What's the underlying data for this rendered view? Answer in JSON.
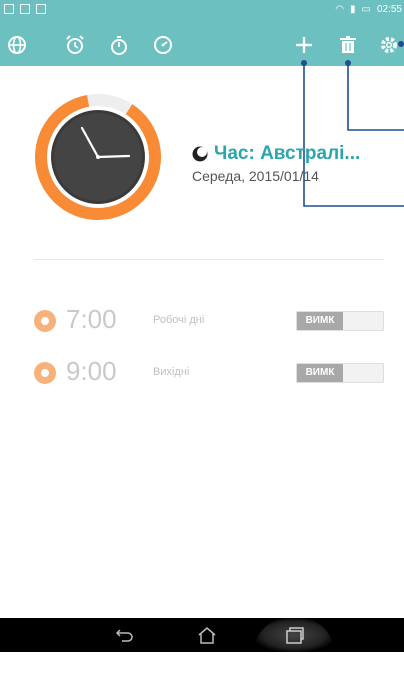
{
  "status_bar": {
    "time": "02:55"
  },
  "toolbar": {
    "icons": [
      "globe-icon",
      "alarm-icon",
      "stopwatch-icon",
      "timer-icon",
      "add-icon",
      "delete-icon",
      "settings-icon"
    ]
  },
  "world_clock": {
    "city": "Час: Австралі...",
    "date": "Середа, 2015/01/14"
  },
  "alarms": [
    {
      "time": "7:00",
      "days": "Робочі дні",
      "toggle_label": "ВИМК"
    },
    {
      "time": "9:00",
      "days": "Вихідні",
      "toggle_label": "ВИМК"
    }
  ],
  "colors": {
    "accent": "#6cc0bf",
    "clock_ring": "#f98a36",
    "title": "#2ba6ad"
  }
}
